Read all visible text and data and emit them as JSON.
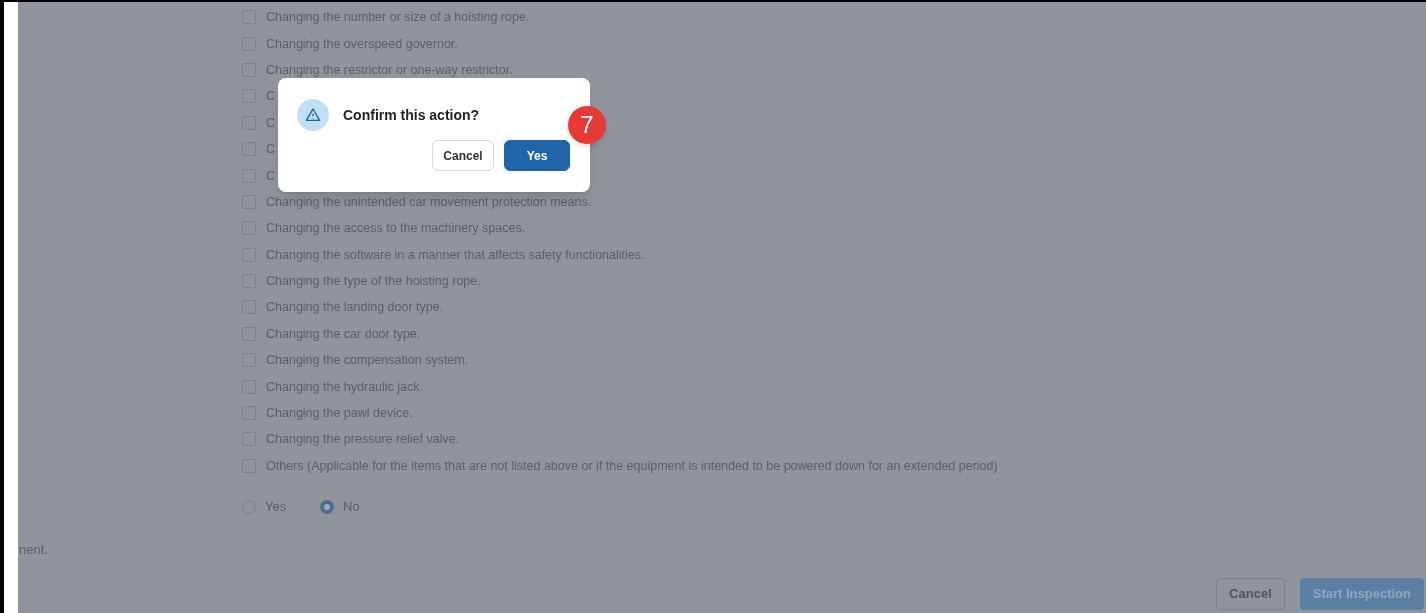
{
  "checklist": [
    {
      "label": "Changing the number or size of a hoisting rope.",
      "checked": false
    },
    {
      "label": "Changing the overspeed governor.",
      "checked": false
    },
    {
      "label": "Changing the restrictor or one-way restrictor.",
      "checked": false
    },
    {
      "label": "C",
      "checked": false
    },
    {
      "label": "C",
      "checked": false
    },
    {
      "label": "C",
      "checked": false
    },
    {
      "label": "C",
      "checked": false
    },
    {
      "label": "Changing the unintended car movement protection means.",
      "checked": false
    },
    {
      "label": "Changing the access to the machinery spaces.",
      "checked": false
    },
    {
      "label": "Changing the software in a manner that affects safety functionalities.",
      "checked": false
    },
    {
      "label": "Changing the type of the hoisting rope.",
      "checked": false
    },
    {
      "label": "Changing the landing door type.",
      "checked": false
    },
    {
      "label": "Changing the car door type.",
      "checked": false
    },
    {
      "label": "Changing the compensation system.",
      "checked": false
    },
    {
      "label": "Changing the hydraulic jack.",
      "checked": false
    },
    {
      "label": "Changing the pawl device.",
      "checked": false
    },
    {
      "label": "Changing the pressure relief valve.",
      "checked": false
    },
    {
      "label": "Others (Applicable for the items that are not listed above or if the equipment is intended to be powered down for an extended period)",
      "checked": false
    }
  ],
  "radio": [
    {
      "label": "Yes",
      "selected": false
    },
    {
      "label": "No",
      "selected": true
    }
  ],
  "note": "nent.",
  "footer_buttons": [
    {
      "label": "Cancel",
      "kind": "secondary"
    },
    {
      "label": "Start Inspection",
      "kind": "primary"
    }
  ],
  "dialog": {
    "title": "Confirm this action?",
    "buttons": [
      {
        "label": "Cancel",
        "kind": "secondary"
      },
      {
        "label": "Yes",
        "kind": "primary"
      }
    ],
    "step_badge": "7"
  }
}
